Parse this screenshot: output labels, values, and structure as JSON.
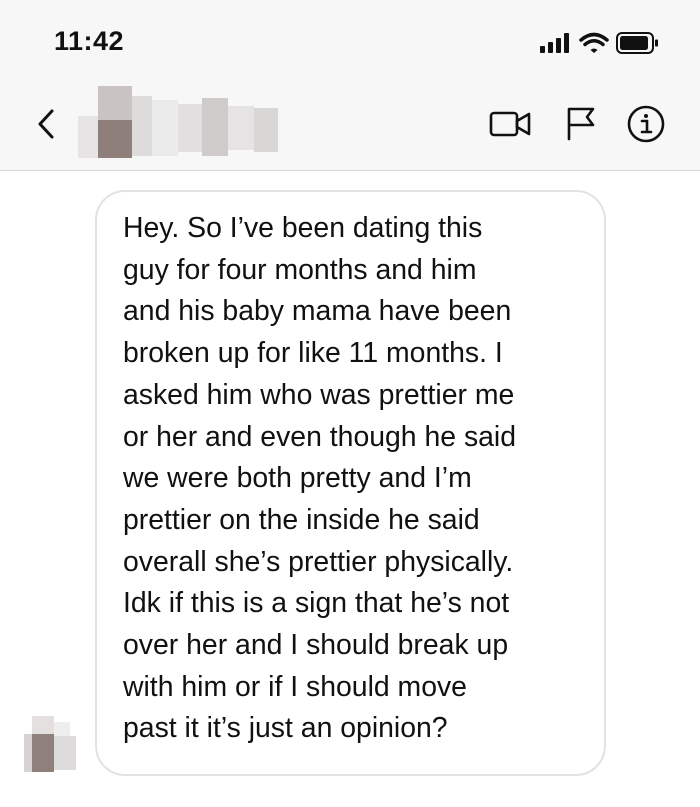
{
  "status": {
    "time": "11:42",
    "icons": [
      "signal-icon",
      "wifi-icon",
      "battery-icon"
    ]
  },
  "header": {
    "contact_name": "",
    "icons": [
      "back-icon",
      "video-call-icon",
      "report-flag-icon",
      "info-icon"
    ]
  },
  "message": {
    "text": "Hey. So I’ve been dating this\nguy for four months and him\nand his baby mama have been\nbroken up for like 11 months. I\nasked him who was prettier me\nor her and even though he said\nwe were both pretty and I’m\nprettier on the inside he said\noverall she’s prettier physically.\nIdk if this is a sign that he’s not\nover her and I should break up\nwith him or if I should move\npast it it’s just an opinion?"
  },
  "colors": {
    "bar_background": "#f7f7f7",
    "bubble_border": "#e2e2e2",
    "text": "#111111"
  }
}
